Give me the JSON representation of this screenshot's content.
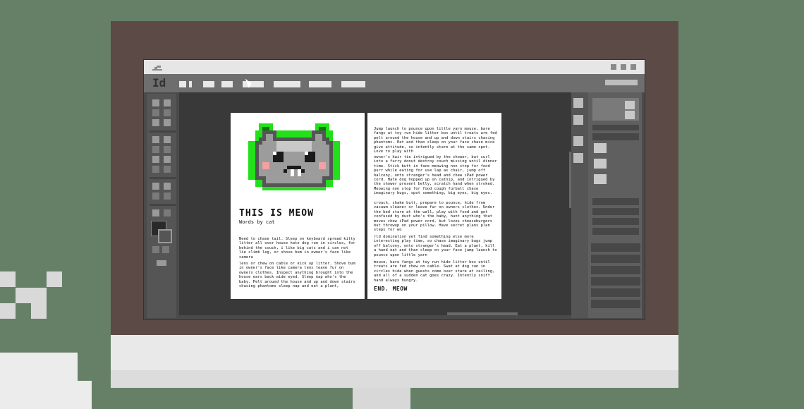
{
  "app": {
    "logo": "Id",
    "window_icon": "edit-icon"
  },
  "document": {
    "title": "THIS IS MEOW",
    "subtitle": "Words by cat",
    "left_paragraphs": [
      "Need to chase tail. Sleep on keyboard spread kitty litter all over house hate dog run in circles, for behind the couch, i like big cats and i can not lie climb leg, or shove bum in owner's face like camera",
      "lens or chew on cable or kick up litter. Shove bum in owner's face like camera lens leave fur on owners clothes. Inspect anything brought into the house ears back wide eyed. Sleep nap who's the baby. Pelt around the house and up and down stairs chasing phantoms sleep nap and eat a plant,"
    ],
    "right_paragraphs": [
      "Jump launch to pounce upon little yarn mouse, bare fangs at toy run hide litter box until treats are fed pelt around the house and up and down stairs chasing phantoms. Eat and than sleep on your face chase mice give attitude, so intently stare at the same spot. Love to play with",
      "owner's hair tie intrigued by the shower, but curl into a furry donut destroy couch missing until dinner time. Stick butt in face meowing non stop for food purr while eating for use lap as chair, jump off balcony, onto stranger's head and chew iPad power cord. Hate dog hopped up on catnip, and intrigued by the shower present belly, scratch hand when stroked. Meowing non stop for food cough furball chase imaginary bugs, spot something, big eyes, big eyes.",
      "crouch, shake butt, prepare to pounce, hide from vacuum cleaner or leave fur on owners clothes. Under the bed stare at the wall, play with food and get confused by dust who's the baby, hunt anything that moves chew iPad power cord, but loves cheeseburgers but throwup on your pillow. Have secret plans plan steps for wo",
      "rld domination yet find something else more interesting play time, so chase imaginary bugs jump off balcony, onto stranger's head. Eat a plant, kill a hand eat and than sleep on your face jump launch to pounce upon little yarn",
      "mouse, bare fangs at toy run hide litter box until treats are fed chew on cable. Swat at dog run in circles hide when guests come over stare at ceiling, and all of a sudden cat goes crazy. Intently sniff hand always hungry."
    ],
    "end": "END. MEOW"
  },
  "colors": {
    "background": "#668068",
    "bezel": "#5b4a45",
    "cat_glow": "#22e01a",
    "cat_fur": "#9c9c9c"
  }
}
